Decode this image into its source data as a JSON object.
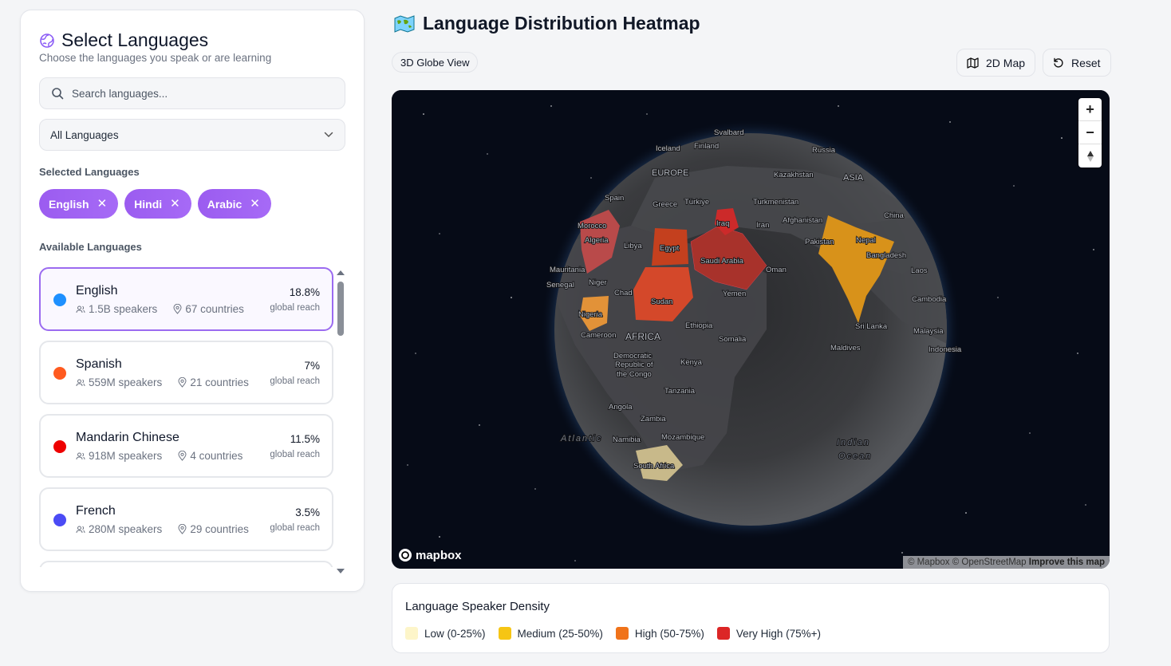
{
  "sidebar": {
    "title": "Select Languages",
    "subtitle": "Choose the languages you speak or are learning",
    "search_placeholder": "Search languages...",
    "filter_value": "All Languages",
    "selected_label": "Selected Languages",
    "selected": [
      "English",
      "Hindi",
      "Arabic"
    ],
    "available_label": "Available Languages",
    "languages": [
      {
        "name": "English",
        "speakers": "1.5B speakers",
        "countries": "67 countries",
        "pct": "18.8%",
        "reach": "global reach",
        "color": "#1e90ff"
      },
      {
        "name": "Spanish",
        "speakers": "559M speakers",
        "countries": "21 countries",
        "pct": "7%",
        "reach": "global reach",
        "color": "#ff5a1f"
      },
      {
        "name": "Mandarin Chinese",
        "speakers": "918M speakers",
        "countries": "4 countries",
        "pct": "11.5%",
        "reach": "global reach",
        "color": "#ee0000"
      },
      {
        "name": "French",
        "speakers": "280M speakers",
        "countries": "29 countries",
        "pct": "3.5%",
        "reach": "global reach",
        "color": "#4b4bf5"
      }
    ]
  },
  "header": {
    "title": "Language Distribution Heatmap",
    "view_badge": "3D Globe View",
    "btn_2d": "2D Map",
    "btn_reset": "Reset"
  },
  "map": {
    "brand": "mapbox",
    "attribution_1": "© Mapbox © OpenStreetMap",
    "attribution_2": "Improve this map",
    "labels": [
      "Svalbard",
      "Iceland",
      "Finland",
      "Russia",
      "EUROPE",
      "Kazakhstan",
      "ASIA",
      "Spain",
      "Türkiye",
      "Turkmenistan",
      "Greece",
      "Iraq",
      "Iran",
      "Afghanistan",
      "China",
      "Morocco",
      "Algeria",
      "Libya",
      "Egypt",
      "Pakistan",
      "Nepal",
      "Bangladesh",
      "Saudi Arabia",
      "Oman",
      "Laos",
      "Mauritania",
      "Senegal",
      "Niger",
      "Chad",
      "Sudan",
      "Yemen",
      "Cambodia",
      "Nigeria",
      "Ethiopia",
      "Sri Lanka",
      "Malaysia",
      "Cameroon",
      "AFRICA",
      "Somalia",
      "Maldives",
      "Indonesia",
      "Democratic",
      "Republic of",
      "the Congo",
      "Kenya",
      "Tanzania",
      "Angola",
      "Zambia",
      "Namibia",
      "Mozambique",
      "South Africa",
      "Indian",
      "Ocean",
      "Atlantic"
    ]
  },
  "legend": {
    "title": "Language Speaker Density",
    "items": [
      {
        "label": "Low (0-25%)",
        "color": "#fdf5c9"
      },
      {
        "label": "Medium (25-50%)",
        "color": "#f6c514"
      },
      {
        "label": "High (50-75%)",
        "color": "#f0731a"
      },
      {
        "label": "Very High (75%+)",
        "color": "#dc2626"
      }
    ]
  }
}
